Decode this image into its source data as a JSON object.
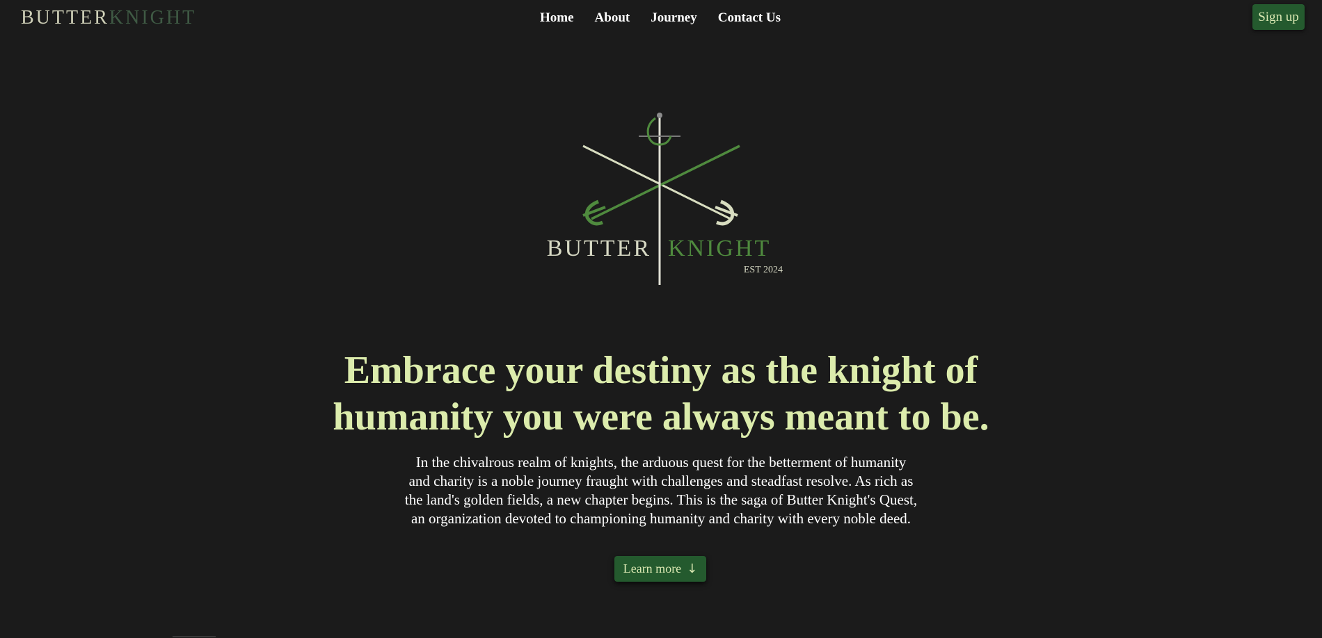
{
  "header": {
    "brand_part1": "BUTTER",
    "brand_part2": "KNIGHT",
    "nav": [
      {
        "label": "Home"
      },
      {
        "label": "About"
      },
      {
        "label": "Journey"
      },
      {
        "label": "Contact Us"
      }
    ],
    "signup_label": "Sign up"
  },
  "logo": {
    "word1": "BUTTER",
    "word2": "KNIGHT",
    "established": "EST 2024",
    "icon": "crossed-swords-emblem"
  },
  "hero": {
    "title_lines": [
      "Embrace your destiny as the knight of",
      "humanity you were always meant to be."
    ],
    "text_lines": [
      "In the chivalrous realm of knights, the arduous quest for the betterment of humanity",
      "and charity is a noble journey fraught with challenges and steadfast resolve. As rich as",
      "the land's golden fields, a new chapter begins. This is the saga of Butter Knight's Quest,",
      "an organization devoted to championing humanity and charity with every noble deed."
    ],
    "cta_label": "Learn more",
    "cta_icon": "arrow-down-icon"
  },
  "colors": {
    "background": "#1b1b1b",
    "accent_green": "#245a2e",
    "title_color": "#dcecac",
    "brand_light": "#cfd0b8",
    "brand_dark": "#3f5a44"
  }
}
